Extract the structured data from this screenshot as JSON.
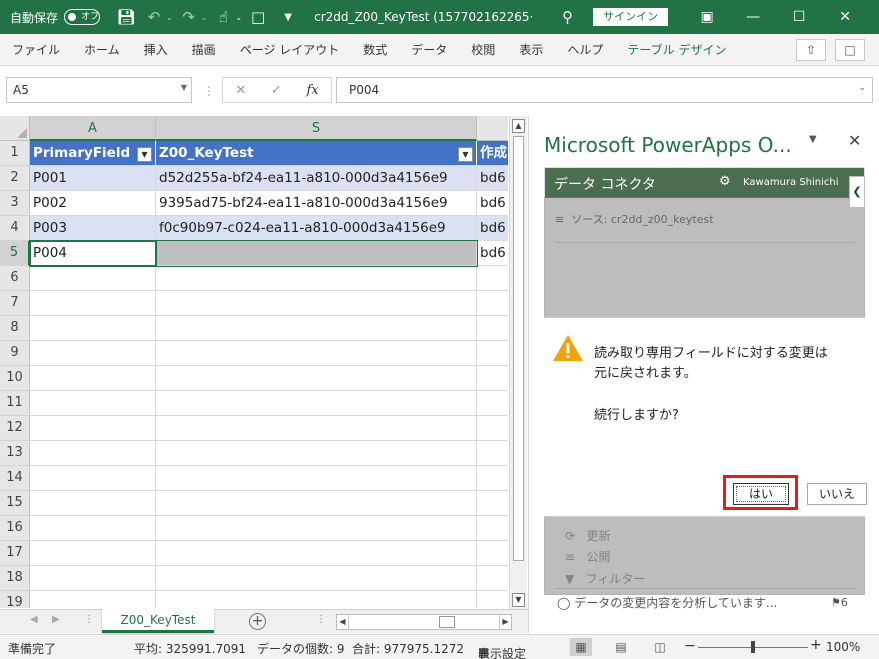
{
  "titlebar": {
    "autosave": "自動保存",
    "autosave_state": "オフ",
    "doc_title": "cr2dd_Z00_KeyTest (157702162265···",
    "signin": "サインイン"
  },
  "ribbon": {
    "tabs": [
      "ファイル",
      "ホーム",
      "挿入",
      "描画",
      "ページ レイアウト",
      "数式",
      "データ",
      "校閲",
      "表示",
      "ヘルプ",
      "テーブル デザイン"
    ],
    "active_tab": "テーブル デザイン"
  },
  "formula_bar": {
    "name_box": "A5",
    "fx": "fx",
    "value": "P004"
  },
  "grid": {
    "columns": [
      "A",
      "S",
      ""
    ],
    "rows": [
      "1",
      "2",
      "3",
      "4",
      "5",
      "6",
      "7",
      "8",
      "9",
      "10",
      "11",
      "12",
      "13",
      "14",
      "15",
      "16",
      "17",
      "18",
      "19"
    ],
    "header": [
      "PrimaryField",
      "Z00_KeyTest",
      "作成"
    ],
    "data": [
      [
        "P001",
        "d52d255a-bf24-ea11-a810-000d3a4156e9",
        "bd6"
      ],
      [
        "P002",
        "9395ad75-bf24-ea11-a810-000d3a4156e9",
        "bd6"
      ],
      [
        "P003",
        "f0c90b97-c024-ea11-a810-000d3a4156e9",
        "bd6"
      ],
      [
        "P004",
        "",
        "bd6"
      ]
    ]
  },
  "sheet": {
    "tab": "Z00_KeyTest"
  },
  "pane": {
    "title": "Microsoft PowerApps O...",
    "app_title": "データ コネクタ",
    "user": "Kawamura Shinichi",
    "source": "ソース: cr2dd_z00_keytest",
    "items": [
      "更新",
      "公開",
      "フィルター"
    ],
    "dialog": {
      "line1": "読み取り専用フィールドに対する変更は",
      "line2": "元に戻されます。",
      "question": "続行しますか?",
      "yes": "はい",
      "no": "いいえ"
    },
    "status": "データの変更内容を分析しています...",
    "flag_count": "6"
  },
  "statusbar": {
    "ready": "準備完了",
    "average": "平均: 325991.7091",
    "count": "データの個数: 9",
    "sum": "合計: 977975.1272",
    "display_settings": "表示設定",
    "zoom": "100%"
  },
  "colors": {
    "excel_green": "#217346",
    "table_header": "#4472c4",
    "table_band": "#d9e1f2",
    "pane_header": "#4b6e51",
    "highlight": "#e01e1e"
  }
}
